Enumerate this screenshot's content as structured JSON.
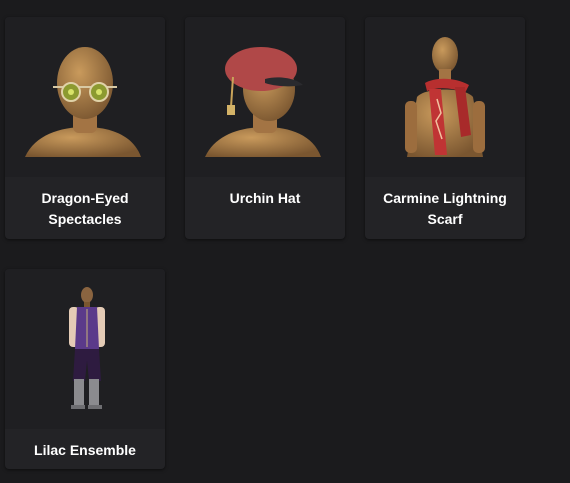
{
  "items": [
    {
      "name": "Dragon-Eyed Spectacles",
      "icon": "mannequin-spectacles-icon"
    },
    {
      "name": "Urchin Hat",
      "icon": "mannequin-hat-icon"
    },
    {
      "name": "Carmine Lightning Scarf",
      "icon": "mannequin-scarf-icon"
    },
    {
      "name": "Lilac Ensemble",
      "icon": "mannequin-ensemble-icon"
    }
  ],
  "colors": {
    "background": "#1b1b1d",
    "card": "#232326",
    "thumb": "#1f1f22",
    "text": "#ffffff"
  }
}
